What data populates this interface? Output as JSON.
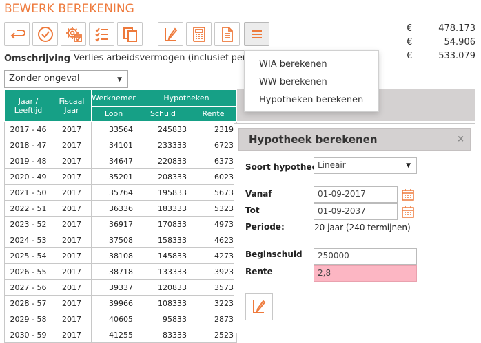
{
  "page": {
    "title": "BEWERK BEREKENING"
  },
  "toolbar": {
    "buttons": [
      {
        "name": "back-button",
        "icon": "undo-arrow-icon"
      },
      {
        "name": "confirm-button",
        "icon": "check-circle-icon"
      },
      {
        "name": "settings-button",
        "icon": "gear-calendar-icon"
      },
      {
        "name": "checklist-button",
        "icon": "checklist-icon"
      },
      {
        "name": "copy-button",
        "icon": "copy-icon"
      },
      {
        "name": "edit-button",
        "icon": "pencil-doc-icon"
      },
      {
        "name": "calculator-button",
        "icon": "calculator-icon"
      },
      {
        "name": "document-button",
        "icon": "document-icon"
      },
      {
        "name": "menu-button",
        "icon": "hamburger-icon"
      }
    ],
    "accent_color": "#ee7a3c"
  },
  "totals": [
    {
      "currency": "€",
      "amount": "478.173"
    },
    {
      "currency": "€",
      "amount": "54.906"
    },
    {
      "currency": "€",
      "amount": "533.079"
    }
  ],
  "omschrijving": {
    "label": "Omschrijving",
    "value": "Verlies arbeidsvermogen (inclusief pensioen)"
  },
  "ongeval": {
    "selected": "Zonder ongeval"
  },
  "dropdown": {
    "items": [
      "WIA berekenen",
      "WW berekenen",
      "Hypotheken berekenen"
    ]
  },
  "table": {
    "header_color": "#16a086",
    "headers": {
      "jaar": "Jaar / Leeftijd",
      "fiscaal": "Fiscaal Jaar",
      "werknemer": "Werknemer",
      "loon": "Loon",
      "hypotheken": "Hypotheken",
      "schuld": "Schuld",
      "rente": "Rente"
    },
    "rows": [
      {
        "jaar": "2017 - 46",
        "fiscaal": "2017",
        "loon": "33564",
        "schuld": "245833",
        "rente": "2319"
      },
      {
        "jaar": "2018 - 47",
        "fiscaal": "2017",
        "loon": "34101",
        "schuld": "233333",
        "rente": "6723"
      },
      {
        "jaar": "2019 - 48",
        "fiscaal": "2017",
        "loon": "34647",
        "schuld": "220833",
        "rente": "6373"
      },
      {
        "jaar": "2020 - 49",
        "fiscaal": "2017",
        "loon": "35201",
        "schuld": "208333",
        "rente": "6023"
      },
      {
        "jaar": "2021 - 50",
        "fiscaal": "2017",
        "loon": "35764",
        "schuld": "195833",
        "rente": "5673"
      },
      {
        "jaar": "2022 - 51",
        "fiscaal": "2017",
        "loon": "36336",
        "schuld": "183333",
        "rente": "5323"
      },
      {
        "jaar": "2023 - 52",
        "fiscaal": "2017",
        "loon": "36917",
        "schuld": "170833",
        "rente": "4973"
      },
      {
        "jaar": "2024 - 53",
        "fiscaal": "2017",
        "loon": "37508",
        "schuld": "158333",
        "rente": "4623"
      },
      {
        "jaar": "2025 - 54",
        "fiscaal": "2017",
        "loon": "38108",
        "schuld": "145833",
        "rente": "4273"
      },
      {
        "jaar": "2026 - 55",
        "fiscaal": "2017",
        "loon": "38718",
        "schuld": "133333",
        "rente": "3923"
      },
      {
        "jaar": "2027 - 56",
        "fiscaal": "2017",
        "loon": "39337",
        "schuld": "120833",
        "rente": "3573"
      },
      {
        "jaar": "2028 - 57",
        "fiscaal": "2017",
        "loon": "39966",
        "schuld": "108333",
        "rente": "3223"
      },
      {
        "jaar": "2029 - 58",
        "fiscaal": "2017",
        "loon": "40605",
        "schuld": "95833",
        "rente": "2873"
      },
      {
        "jaar": "2030 - 59",
        "fiscaal": "2017",
        "loon": "41255",
        "schuld": "83333",
        "rente": "2523"
      }
    ]
  },
  "panel": {
    "title": "Hypotheek berekenen",
    "close": "×",
    "soort_label": "Soort hypotheek",
    "soort_value": "Lineair",
    "vanaf_label": "Vanaf",
    "vanaf_value": "01-09-2017",
    "tot_label": "Tot",
    "tot_value": "01-09-2037",
    "periode_label": "Periode:",
    "periode_value": "20 jaar (240 termijnen)",
    "beginschuld_label": "Beginschuld",
    "beginschuld_value": "250000",
    "rente_label": "Rente",
    "rente_value": "2,8",
    "rente_error_color": "#fcb6c3"
  }
}
